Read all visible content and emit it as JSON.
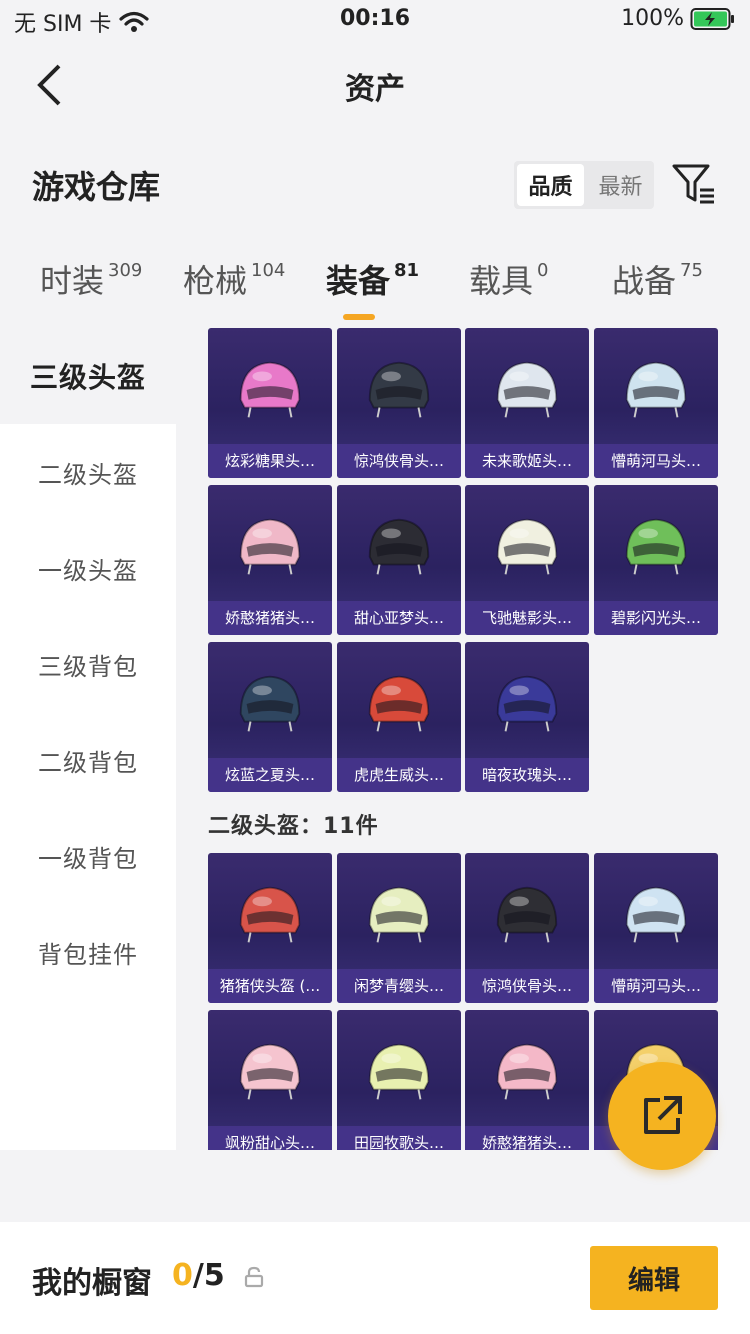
{
  "status": {
    "carrier": "无 SIM 卡",
    "time": "00:16",
    "battery": "100%"
  },
  "nav": {
    "title": "资产"
  },
  "section": {
    "title": "游戏仓库"
  },
  "sort": {
    "options": [
      "品质",
      "最新"
    ]
  },
  "tabs": [
    {
      "label": "时装",
      "count": "309"
    },
    {
      "label": "枪械",
      "count": "104"
    },
    {
      "label": "装备",
      "count": "81"
    },
    {
      "label": "载具",
      "count": "0"
    },
    {
      "label": "战备",
      "count": "75"
    }
  ],
  "sidemenu": [
    "三级头盔",
    "二级头盔",
    "一级头盔",
    "三级背包",
    "二级背包",
    "一级背包",
    "背包挂件"
  ],
  "groups": {
    "level3": {
      "items": [
        "炫彩糖果头…",
        "惊鸿侠骨头…",
        "未来歌姬头…",
        "懵萌河马头…",
        "娇憨猪猪头…",
        "甜心亚梦头…",
        "飞驰魅影头…",
        "碧影闪光头…",
        "炫蓝之夏头…",
        "虎虎生威头…",
        "暗夜玫瑰头…"
      ]
    },
    "level2": {
      "title": "二级头盔：11件",
      "items": [
        "猪猪侠头盔 (…",
        "闲梦青缨头…",
        "惊鸿侠骨头…",
        "懵萌河马头…",
        "飒粉甜心头…",
        "田园牧歌头…",
        "娇憨猪猪头…",
        ""
      ]
    }
  },
  "bottom": {
    "title": "我的橱窗",
    "used": "0",
    "total": "/5",
    "edit": "编辑"
  },
  "colors": {
    "accent": "#f5b320",
    "card_top": "#3a2b6e",
    "card_label": "#46348c"
  }
}
